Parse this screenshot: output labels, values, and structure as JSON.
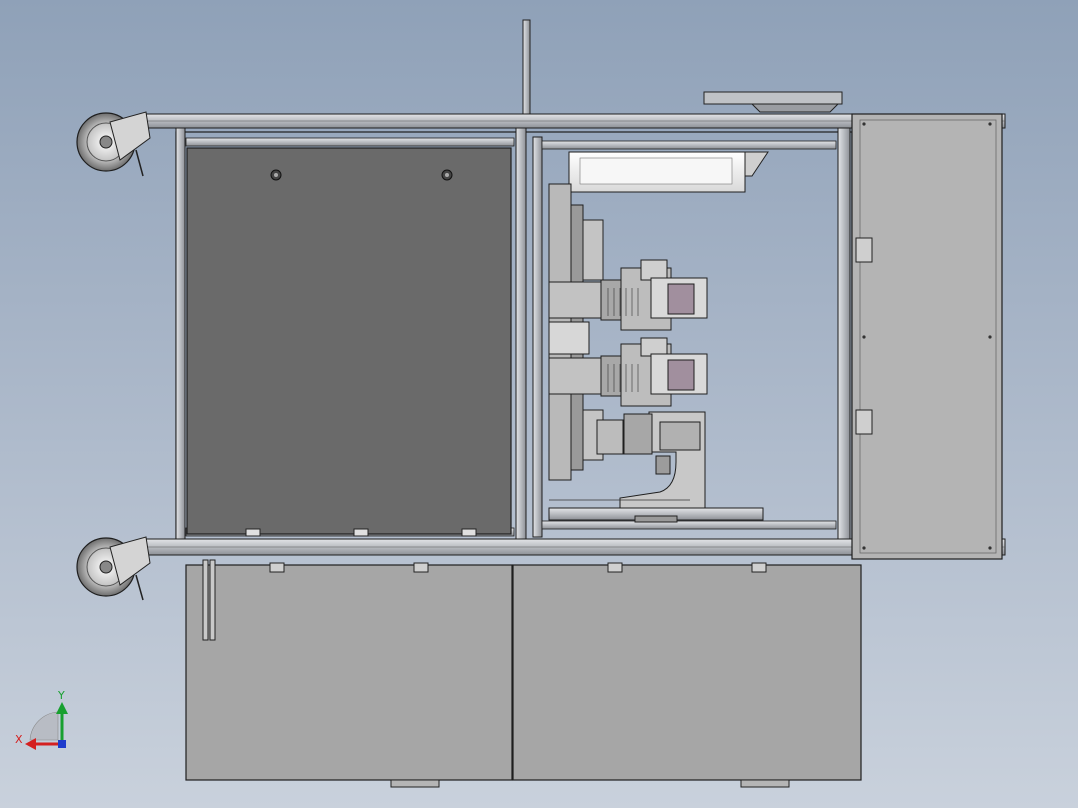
{
  "view": {
    "background_top": "#8fa1b8",
    "background_bottom": "#c9d1dc",
    "panel_fill": "#a6a6a6",
    "dark_panel_fill": "#6a6a6a",
    "frame_fill": "#c4c7cc",
    "line_color": "#1e1e1e"
  },
  "triad": {
    "x_label": "X",
    "y_label": "Y",
    "x_color": "#d42020",
    "y_color": "#18a030",
    "z_color": "#1e3ccc"
  }
}
